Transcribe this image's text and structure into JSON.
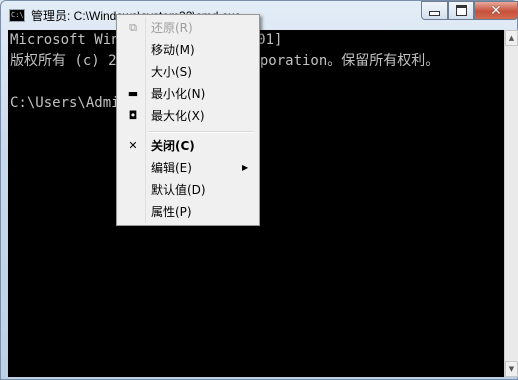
{
  "window": {
    "title": "管理员: C:\\Windows\\system32\\cmd.exe",
    "icon_text": "C:\\"
  },
  "console": {
    "lines": [
      "Microsoft Windows [版本 6.1.7601]",
      "版权所有 (c) 2009 Microsoft Corporation。保留所有权利。",
      "",
      "C:\\Users\\Administrator>"
    ]
  },
  "system_menu": {
    "items": [
      {
        "label": "还原(R)",
        "icon": "restore-icon",
        "enabled": false
      },
      {
        "label": "移动(M)",
        "icon": "",
        "enabled": true
      },
      {
        "label": "大小(S)",
        "icon": "",
        "enabled": true
      },
      {
        "label": "最小化(N)",
        "icon": "minimize-icon",
        "enabled": true
      },
      {
        "label": "最大化(X)",
        "icon": "maximize-icon",
        "enabled": true
      },
      {
        "label": "关闭(C)",
        "icon": "close-icon",
        "enabled": true,
        "bold": true
      },
      {
        "label": "编辑(E)",
        "icon": "",
        "enabled": true,
        "submenu": true
      },
      {
        "label": "默认值(D)",
        "icon": "",
        "enabled": true
      },
      {
        "label": "属性(P)",
        "icon": "",
        "enabled": true
      }
    ]
  },
  "colors": {
    "console_bg": "#000000",
    "console_text": "#c0c0c0",
    "close_button": "#c7503a"
  }
}
